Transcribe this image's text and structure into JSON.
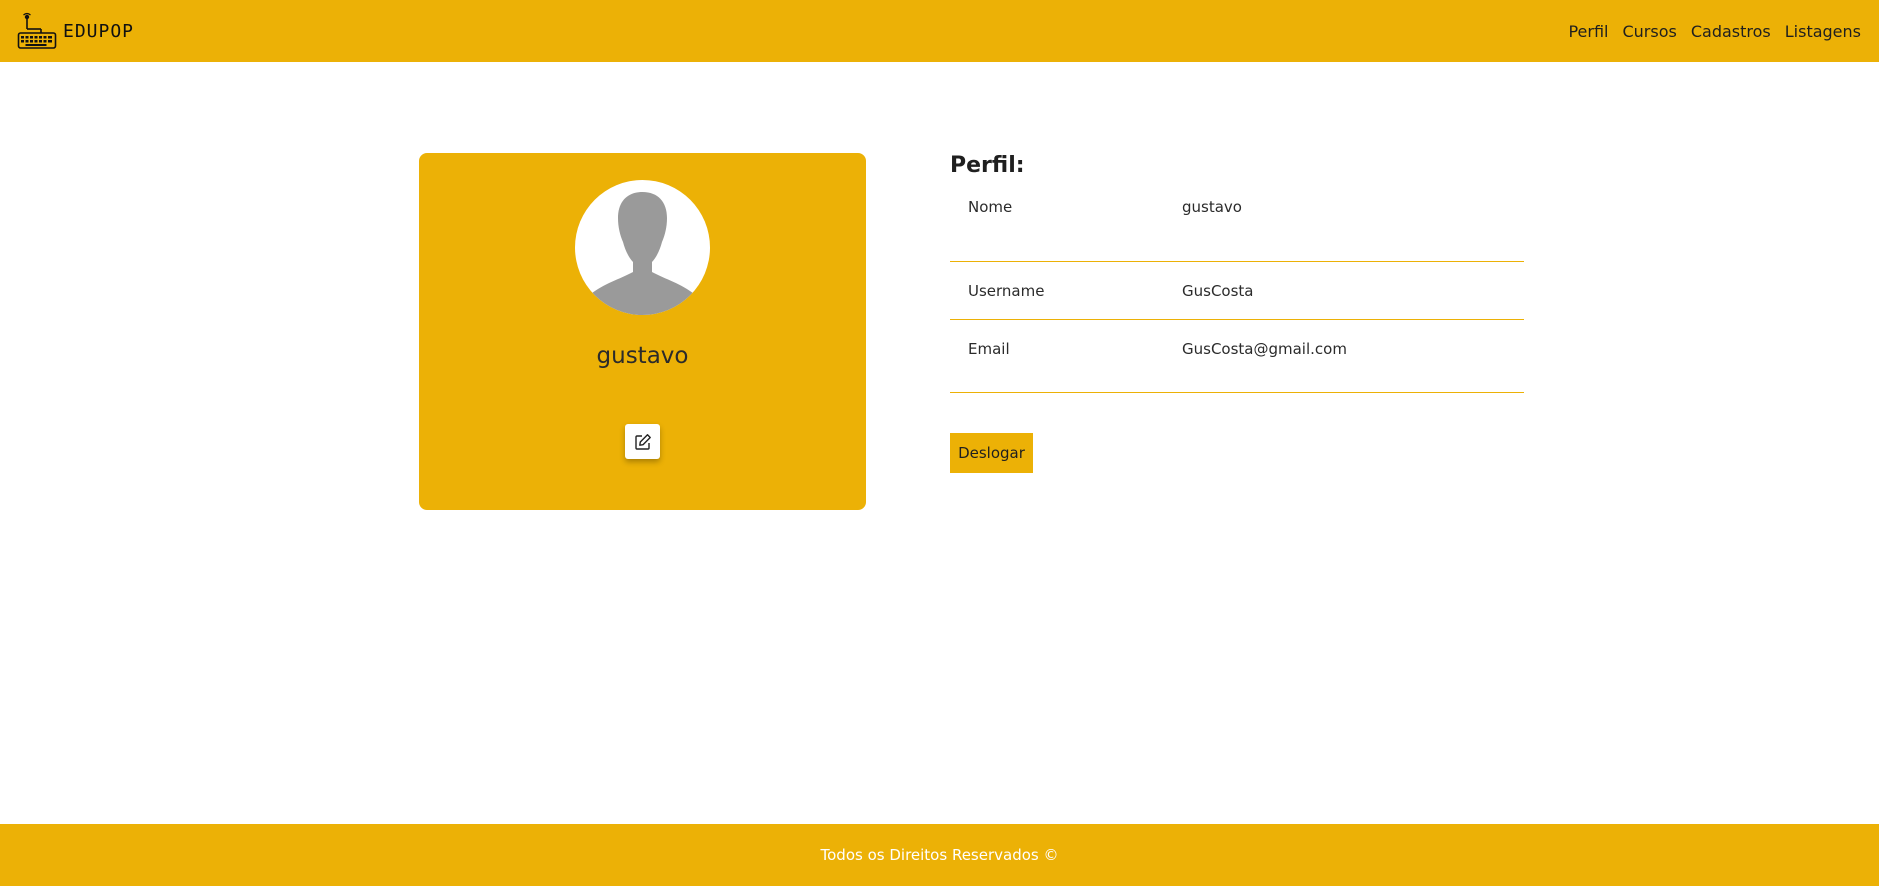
{
  "navbar": {
    "brand_name": "EDUPOP",
    "logo_icon": "keyboard-antenna-icon",
    "links": [
      "Perfil",
      "Cursos",
      "Cadastros",
      "Listagens"
    ]
  },
  "profile_card": {
    "avatar_icon": "user-silhouette-icon",
    "name": "gustavo",
    "edit_icon": "edit-icon"
  },
  "info": {
    "title": "Perfil:",
    "rows": [
      {
        "label": "Nome",
        "value": "gustavo"
      },
      {
        "label": "Username",
        "value": "GusCosta"
      },
      {
        "label": "Email",
        "value": "GusCosta@gmail.com"
      }
    ]
  },
  "actions": {
    "logout_label": "Deslogar"
  },
  "footer": {
    "text": "Todos os Direitos Reservados ©"
  },
  "colors": {
    "accent": "#ecb106",
    "avatar_gray": "#9a9a9a"
  }
}
